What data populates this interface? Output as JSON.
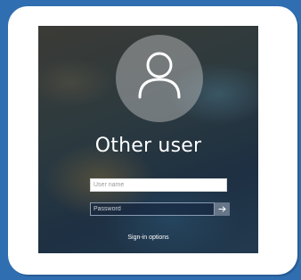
{
  "login": {
    "account_name": "Other user",
    "username_placeholder": "User name",
    "password_placeholder": "Password",
    "signin_options_label": "Sign-in options",
    "submit_icon": "arrow-right-icon",
    "avatar_icon": "user-avatar-icon"
  },
  "colors": {
    "page_background": "#2f6eb0",
    "card_background": "#ffffff",
    "text": "#ffffff"
  }
}
